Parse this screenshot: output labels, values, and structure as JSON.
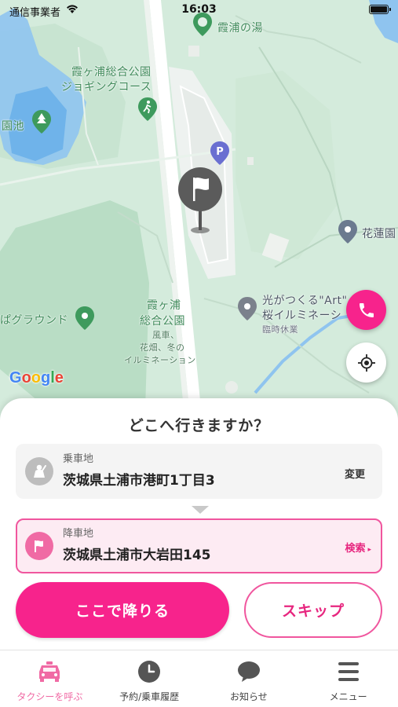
{
  "status_bar": {
    "carrier": "通信事業者",
    "time": "16:03"
  },
  "map": {
    "labels": {
      "onsen": "霞浦の湯",
      "jogging_line1": "霞ヶ浦総合公園",
      "jogging_line2": "ジョギングコース",
      "pond": "園池",
      "ground": "ぱグラウンド",
      "park_line1": "霞ヶ浦",
      "park_line2": "総合公園",
      "park_sub1": "風車、",
      "park_sub2": "花畑、冬の",
      "park_sub3": "イルミネーション",
      "flower": "花蓮園",
      "art_line1": "光がつくる\"Art\"",
      "art_line2": "桜イルミネーシ",
      "art_line3": "臨時休業"
    },
    "google": "Google",
    "icons": [
      "parking-icon",
      "flag-icon",
      "hiker-icon",
      "tree-icon",
      "phone-icon",
      "locate-icon"
    ]
  },
  "sheet": {
    "title": "どこへ行きますか？",
    "pickup": {
      "label": "乗車地",
      "address": "茨城県土浦市港町1丁目3",
      "action": "変更"
    },
    "dropoff": {
      "label": "降車地",
      "address": "茨城県土浦市大岩田145",
      "action": "検索"
    },
    "primary_button": "ここで降りる",
    "secondary_button": "スキップ"
  },
  "tabs": [
    {
      "label": "タクシーを呼ぶ",
      "icon": "taxi-icon",
      "active": true
    },
    {
      "label": "予約/乗車履歴",
      "icon": "clock-icon",
      "active": false
    },
    {
      "label": "お知らせ",
      "icon": "chat-bubble-icon",
      "active": false
    },
    {
      "label": "メニュー",
      "icon": "menu-icon",
      "active": false
    }
  ],
  "colors": {
    "accent": "#f7238c",
    "accent_light": "#fdebf3",
    "map_green": "#d3eadb"
  }
}
